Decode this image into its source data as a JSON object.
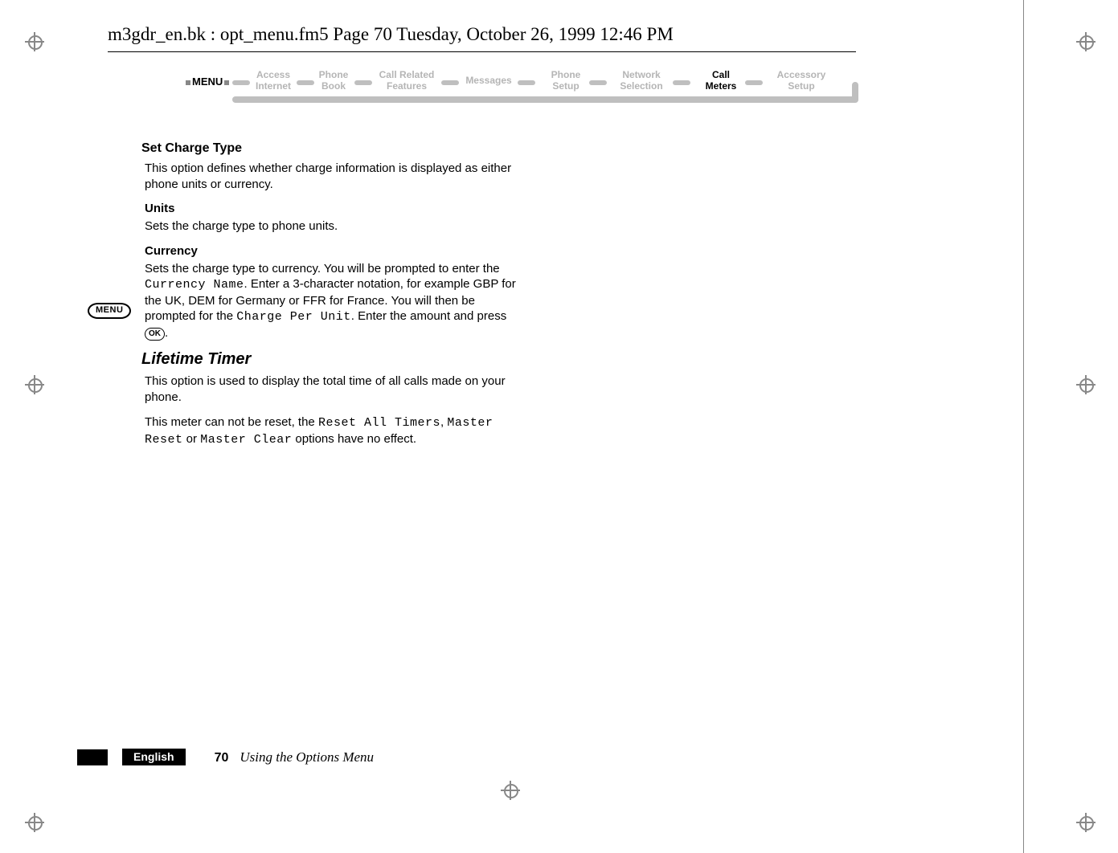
{
  "header_line": "m3gdr_en.bk : opt_menu.fm5  Page 70  Tuesday, October 26, 1999  12:46 PM",
  "menu_banner": {
    "menu_label": "MENU",
    "items": [
      {
        "line1": "Access",
        "line2": "Internet",
        "active": false
      },
      {
        "line1": "Phone",
        "line2": "Book",
        "active": false
      },
      {
        "line1": "Call Related",
        "line2": "Features",
        "active": false
      },
      {
        "line1": "Messages",
        "line2": "",
        "active": false
      },
      {
        "line1": "Phone",
        "line2": "Setup",
        "active": false
      },
      {
        "line1": "Network",
        "line2": "Selection",
        "active": false
      },
      {
        "line1": "Call",
        "line2": "Meters",
        "active": true
      },
      {
        "line1": "Accessory",
        "line2": "Setup",
        "active": false
      }
    ]
  },
  "menu_badge": "MENU",
  "body": {
    "h_set_charge_type": "Set Charge Type",
    "p_set_charge_type": "This option defines whether charge information is displayed as either phone units or currency.",
    "sub_units": "Units",
    "p_units": "Sets the charge type to phone units.",
    "sub_currency": "Currency",
    "p_currency_1a": "Sets the charge type to currency. You will be prompted to enter the ",
    "lcd_currency_name": "Currency Name",
    "p_currency_1b": ". Enter a 3-character notation, for example GBP for the UK, DEM for Germany or FFR for France. You will then be prompted for the ",
    "lcd_charge_per_unit": "Charge Per Unit",
    "p_currency_1c": ". Enter the amount and press ",
    "ok_label": "OK",
    "p_currency_1d": ".",
    "h_lifetime_timer": "Lifetime Timer",
    "p_lifetime_1": "This option is used to display the total time of all calls made on your phone.",
    "p_lifetime_2a": "This meter can not be reset, the ",
    "lcd_reset_all": "Reset All Timers",
    "p_lifetime_2b": ", ",
    "lcd_master_reset": "Master Reset",
    "p_lifetime_2c": " or ",
    "lcd_master_clear": "Master Clear",
    "p_lifetime_2d": " options have no effect."
  },
  "footer": {
    "language": "English",
    "page_number": "70",
    "section_title": "Using the Options Menu"
  }
}
